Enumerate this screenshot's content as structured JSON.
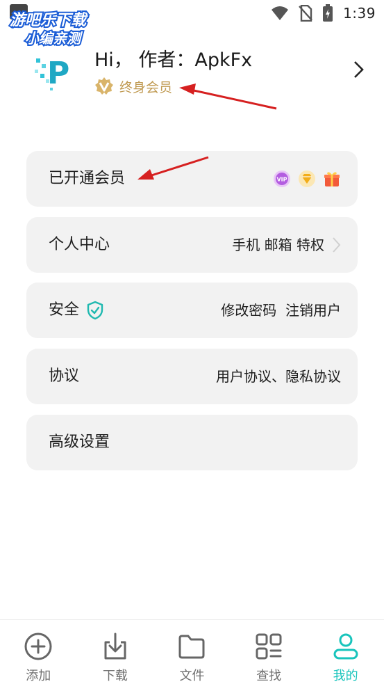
{
  "status_bar": {
    "time": "1:39"
  },
  "watermark": {
    "line1": "游吧乐下载",
    "line2": "小编亲测"
  },
  "profile": {
    "greeting": "Hi， 作者：ApkFx",
    "membership": "终身会员",
    "logo_letter": "P"
  },
  "menu": {
    "membership": {
      "label": "已开通会员"
    },
    "personal": {
      "label": "个人中心",
      "detail": "手机 邮箱 特权"
    },
    "security": {
      "label": "安全",
      "detail": "修改密码  注销用户"
    },
    "agreement": {
      "label": "协议",
      "detail": "用户协议、隐私协议"
    },
    "advanced": {
      "label": "高级设置"
    }
  },
  "tabbar": {
    "tabs": [
      {
        "label": "添加",
        "icon": "plus-circle-icon"
      },
      {
        "label": "下载",
        "icon": "download-icon"
      },
      {
        "label": "文件",
        "icon": "folder-icon"
      },
      {
        "label": "查找",
        "icon": "grid-search-icon"
      },
      {
        "label": "我的",
        "icon": "user-icon"
      }
    ],
    "active_index": 4
  },
  "colors": {
    "accent": "#18c4bc",
    "gold": "#c09a52",
    "card_bg": "#f2f2f2",
    "annotation_arrow": "#d62020"
  }
}
